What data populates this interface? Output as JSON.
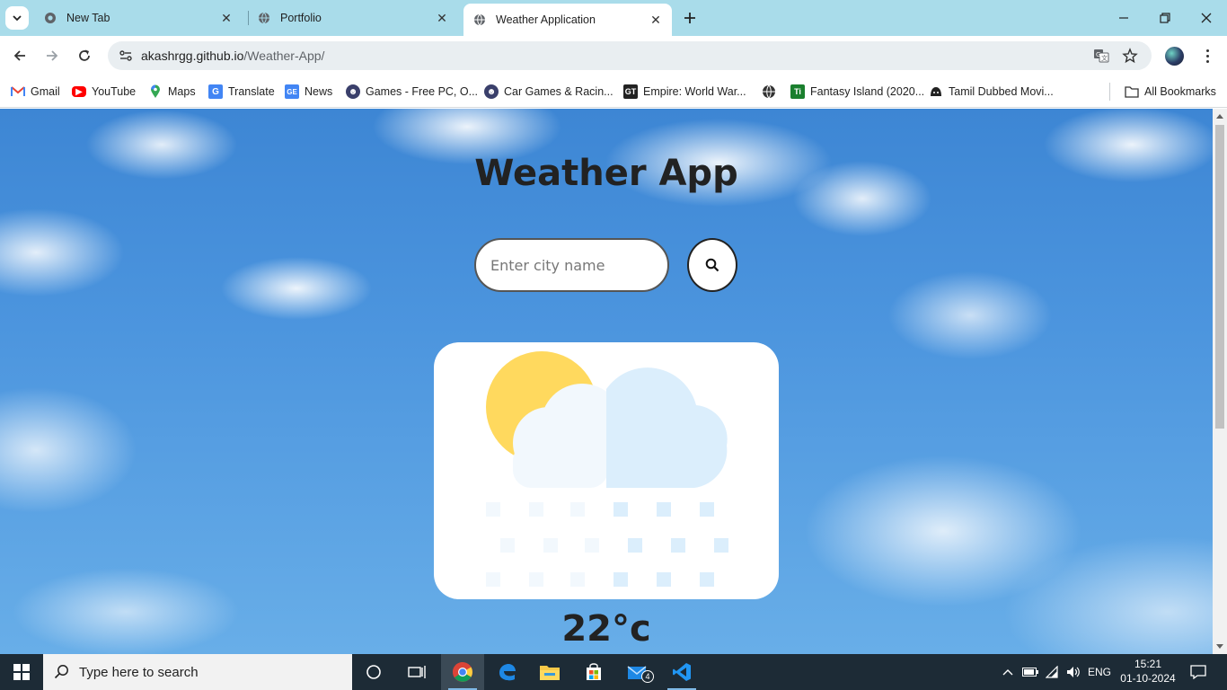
{
  "browser": {
    "tabs": [
      {
        "title": "New Tab",
        "active": false
      },
      {
        "title": "Portfolio",
        "active": false
      },
      {
        "title": "Weather Application",
        "active": true
      }
    ],
    "address": {
      "host": "akashrgg.github.io",
      "path": "/Weather-App/"
    },
    "bookmarks": [
      {
        "label": "Gmail",
        "icon": "gmail-icon"
      },
      {
        "label": "YouTube",
        "icon": "youtube-icon"
      },
      {
        "label": "Maps",
        "icon": "maps-icon"
      },
      {
        "label": "Translate",
        "icon": "translate-icon"
      },
      {
        "label": "News",
        "icon": "news-icon"
      },
      {
        "label": "Games - Free PC, O...",
        "icon": "games-icon"
      },
      {
        "label": "Car Games & Racin...",
        "icon": "car-games-icon"
      },
      {
        "label": "Empire: World War...",
        "icon": "empire-icon"
      },
      {
        "label": "",
        "icon": "globe-icon"
      },
      {
        "label": "Fantasy Island (2020...",
        "icon": "fantasy-island-icon"
      },
      {
        "label": "Tamil Dubbed Movi...",
        "icon": "tamil-movies-icon"
      }
    ],
    "all_bookmarks_label": "All Bookmarks"
  },
  "page": {
    "title": "Weather App",
    "search": {
      "placeholder": "Enter city name",
      "value": ""
    },
    "weather_icon": "snow-cloud-sun-icon",
    "temperature": "22°c"
  },
  "taskbar": {
    "search_placeholder": "Type here to search",
    "mail_badge": "4",
    "language": "ENG",
    "time": "15:21",
    "date": "01-10-2024"
  },
  "colors": {
    "tabstrip": "#a9dcea",
    "sky": "#4c95de",
    "card": "#ffffff",
    "sun": "#ffd95e",
    "cloud_light": "#f2f8fd",
    "cloud_blue": "#dbeefc",
    "taskbar": "#1d2b36"
  }
}
